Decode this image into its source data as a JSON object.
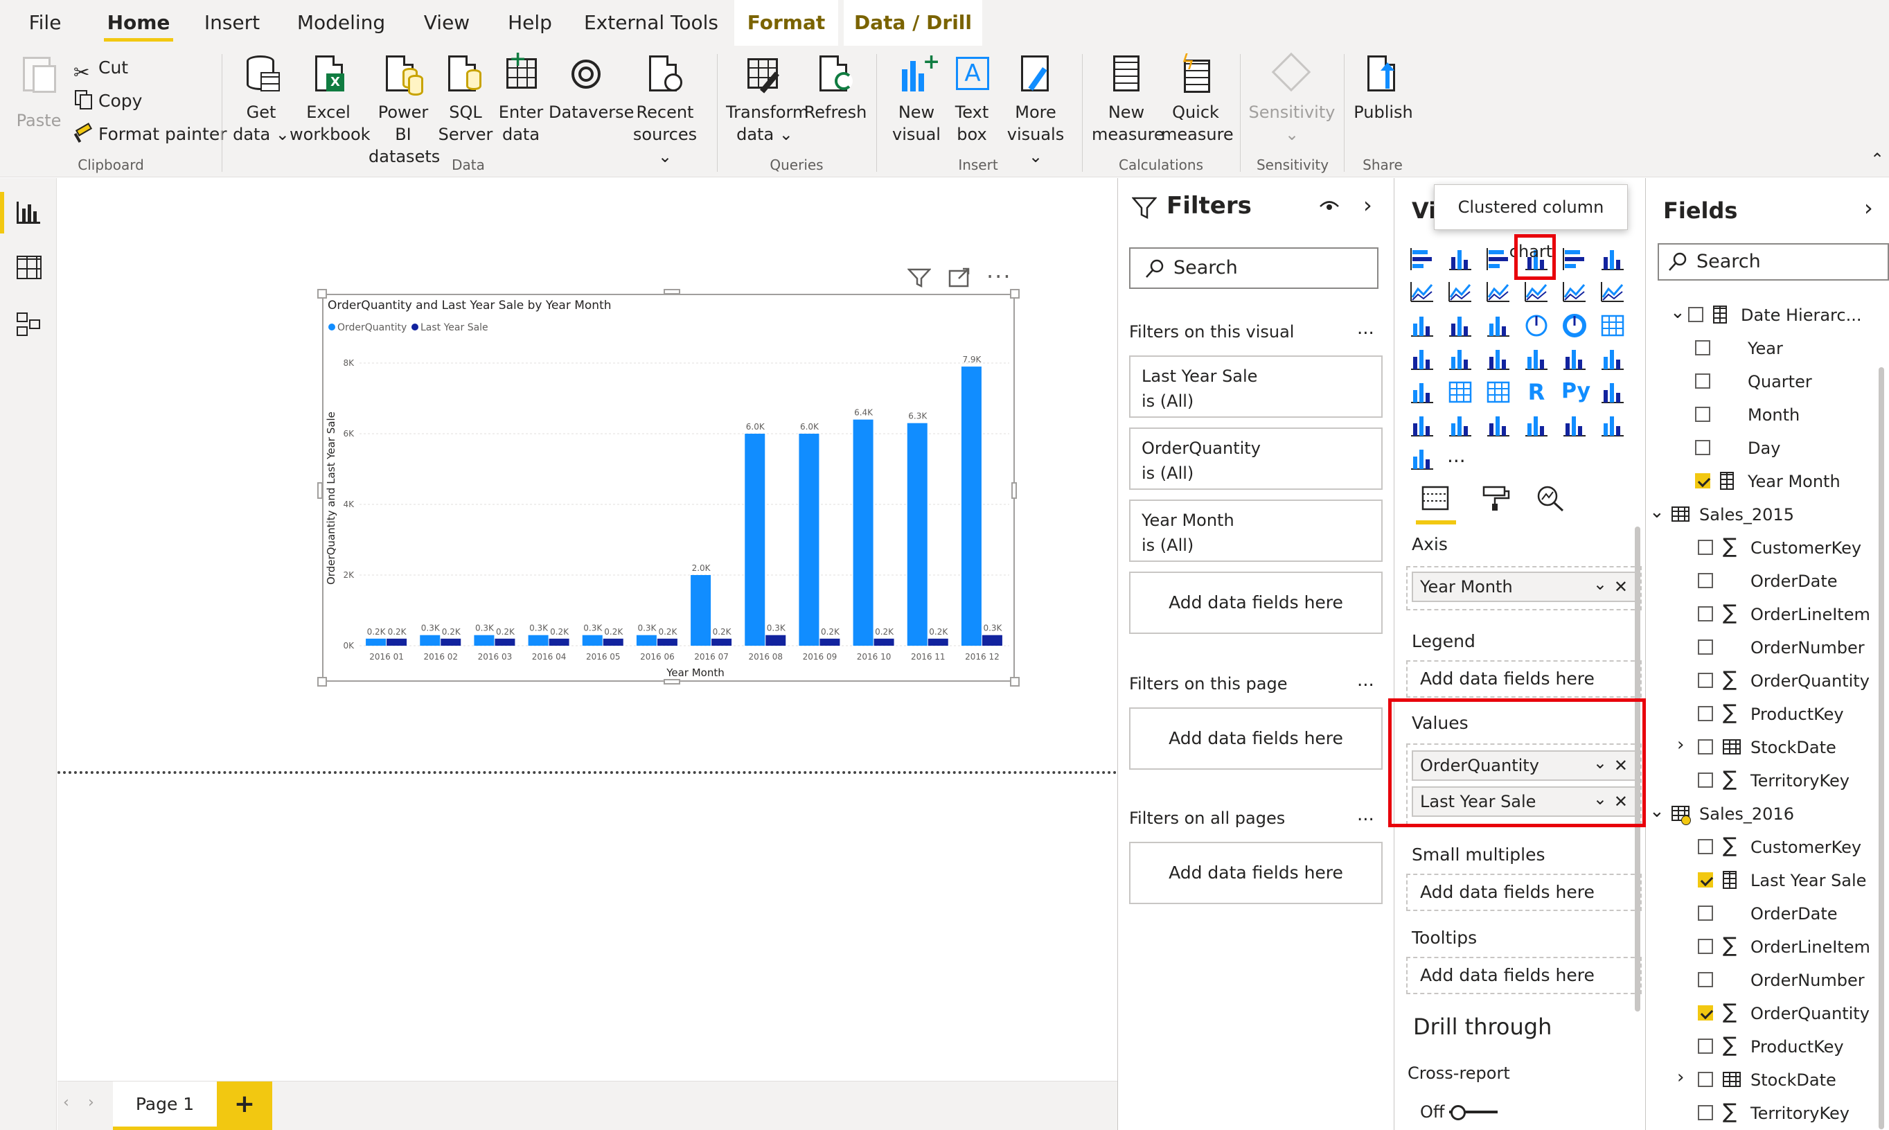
{
  "menu": {
    "file": "File",
    "home": "Home",
    "insert": "Insert",
    "modeling": "Modeling",
    "view": "View",
    "help": "Help",
    "external_tools": "External Tools",
    "format": "Format",
    "data_drill": "Data / Drill"
  },
  "ribbon": {
    "clipboard": {
      "paste": "Paste",
      "cut": "Cut",
      "copy": "Copy",
      "format_painter": "Format painter",
      "label": "Clipboard"
    },
    "data": {
      "get_data_1": "Get",
      "get_data_2": "data",
      "excel_1": "Excel",
      "excel_2": "workbook",
      "pbi_1": "Power BI",
      "pbi_2": "datasets",
      "sql_1": "SQL",
      "sql_2": "Server",
      "enter_1": "Enter",
      "enter_2": "data",
      "dataverse": "Dataverse",
      "recent_1": "Recent",
      "recent_2": "sources",
      "label": "Data"
    },
    "queries": {
      "transform_1": "Transform",
      "transform_2": "data",
      "refresh": "Refresh",
      "label": "Queries"
    },
    "insert": {
      "new_visual_1": "New",
      "new_visual_2": "visual",
      "text_box_1": "Text",
      "text_box_2": "box",
      "more_visuals_1": "More",
      "more_visuals_2": "visuals",
      "label": "Insert"
    },
    "calculations": {
      "new_measure_1": "New",
      "new_measure_2": "measure",
      "quick_measure_1": "Quick",
      "quick_measure_2": "measure",
      "label": "Calculations"
    },
    "sensitivity": {
      "button": "Sensitivity",
      "label": "Sensitivity"
    },
    "share": {
      "publish": "Publish",
      "label": "Share"
    }
  },
  "chart_data": {
    "type": "bar",
    "title": "OrderQuantity and Last Year Sale by Year Month",
    "xlabel": "Year Month",
    "ylabel": "OrderQuantity and Last Year Sale",
    "ylim": [
      0,
      8000
    ],
    "yticks": [
      "0K",
      "2K",
      "4K",
      "6K",
      "8K"
    ],
    "ytick_values": [
      0,
      2000,
      4000,
      6000,
      8000
    ],
    "grid": true,
    "legend_position": "top-left",
    "categories": [
      "2016 01",
      "2016 02",
      "2016 03",
      "2016 04",
      "2016 05",
      "2016 06",
      "2016 07",
      "2016 08",
      "2016 09",
      "2016 10",
      "2016 11",
      "2016 12"
    ],
    "series": [
      {
        "name": "OrderQuantity",
        "color": "#118dff",
        "values": [
          200,
          300,
          300,
          300,
          300,
          300,
          2000,
          6000,
          6000,
          6400,
          6300,
          7900
        ],
        "labels": [
          "0.2K",
          "0.3K",
          "0.3K",
          "0.3K",
          "0.3K",
          "0.3K",
          "2.0K",
          "6.0K",
          "6.0K",
          "6.4K",
          "6.3K",
          "7.9K"
        ]
      },
      {
        "name": "Last Year Sale",
        "color": "#12239e",
        "values": [
          200,
          200,
          200,
          200,
          200,
          200,
          200,
          300,
          200,
          200,
          200,
          300
        ],
        "labels": [
          "0.2K",
          "0.2K",
          "0.2K",
          "0.2K",
          "0.2K",
          "0.2K",
          "0.2K",
          "0.3K",
          "0.2K",
          "0.2K",
          "0.2K",
          "0.3K"
        ]
      }
    ]
  },
  "page_tab": {
    "name": "Page 1",
    "add": "+"
  },
  "filters": {
    "title": "Filters",
    "search_placeholder": "Search",
    "on_visual": "Filters on this visual",
    "on_page": "Filters on this page",
    "on_all": "Filters on all pages",
    "dots": "...",
    "cards": [
      {
        "name": "Last Year Sale",
        "state": "is (All)"
      },
      {
        "name": "OrderQuantity",
        "state": "is (All)"
      },
      {
        "name": "Year Month",
        "state": "is (All)"
      }
    ],
    "add_fields": "Add data fields here"
  },
  "viz": {
    "title": "Vi",
    "tooltip": "Clustered column chart",
    "axis": "Axis",
    "axis_field": "Year Month",
    "legend": "Legend",
    "values": "Values",
    "value_fields": [
      "OrderQuantity",
      "Last Year Sale"
    ],
    "small_multiples": "Small multiples",
    "tooltips": "Tooltips",
    "add_fields": "Add data fields here",
    "drill_through": "Drill through",
    "cross_report": "Cross-report",
    "off": "Off",
    "more": "...",
    "r_label": "R",
    "py_label": "Py"
  },
  "fields": {
    "title": "Fields",
    "search_placeholder": "Search",
    "date_hierarchy": "Date Hierarc...",
    "year": "Year",
    "quarter": "Quarter",
    "month": "Month",
    "day": "Day",
    "year_month": "Year Month",
    "sales_2015": "Sales_2015",
    "sales_2016": "Sales_2016",
    "customer_key": "CustomerKey",
    "order_date": "OrderDate",
    "order_line_item": "OrderLineItem",
    "order_number": "OrderNumber",
    "order_quantity": "OrderQuantity",
    "product_key": "ProductKey",
    "stock_date": "StockDate",
    "territory_key": "TerritoryKey",
    "last_year_sale": "Last Year Sale"
  },
  "colors": {
    "accent": "#f2c811",
    "highlight": "#e8000b",
    "series1": "#118dff",
    "series2": "#12239e"
  }
}
